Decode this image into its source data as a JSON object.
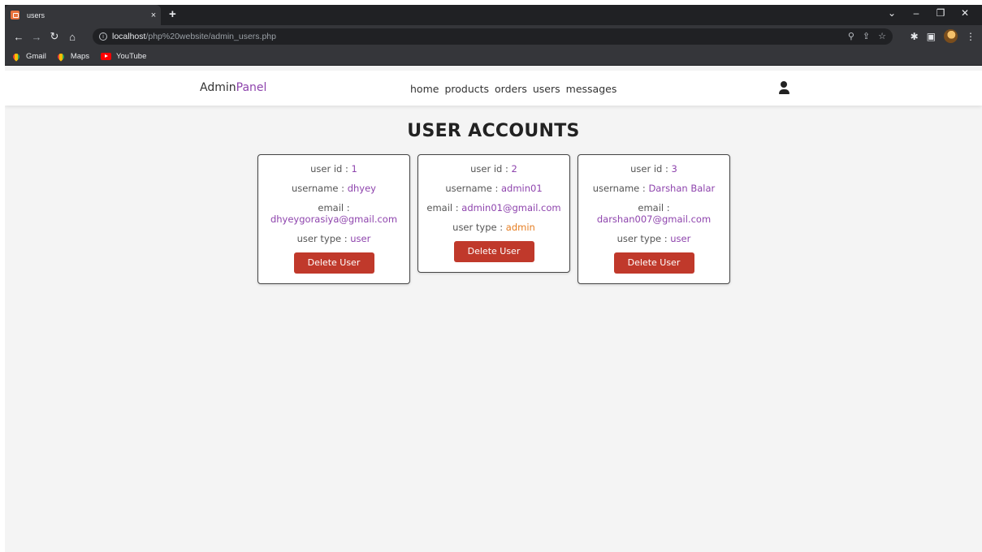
{
  "browser": {
    "tab_title": "users",
    "tab_close": "×",
    "new_tab": "+",
    "url_host": "localhost",
    "url_path": "/php%20website/admin_users.php",
    "bookmarks": [
      "Gmail",
      "Maps",
      "YouTube"
    ]
  },
  "header": {
    "logo_main": "Admin",
    "logo_accent": "Panel",
    "nav": [
      "home",
      "products",
      "orders",
      "users",
      "messages"
    ]
  },
  "page": {
    "title": "USER ACCOUNTS"
  },
  "labels": {
    "user_id": "user id : ",
    "username": "username : ",
    "email": "email : ",
    "user_type": "user type : ",
    "delete_button": "Delete User"
  },
  "users": [
    {
      "id": "1",
      "username": "dhyey",
      "email": "dhyeygorasiya@gmail.com",
      "type": "user"
    },
    {
      "id": "2",
      "username": "admin01",
      "email": "admin01@gmail.com",
      "type": "admin"
    },
    {
      "id": "3",
      "username": "Darshan Balar",
      "email": "darshan007@gmail.com",
      "type": "user"
    }
  ],
  "colors": {
    "accent": "#8e44ad",
    "admin": "#e67e22",
    "delete": "#c0392b"
  },
  "icons": {
    "user": "user-icon",
    "reload": "reload-icon",
    "home": "home-icon"
  }
}
